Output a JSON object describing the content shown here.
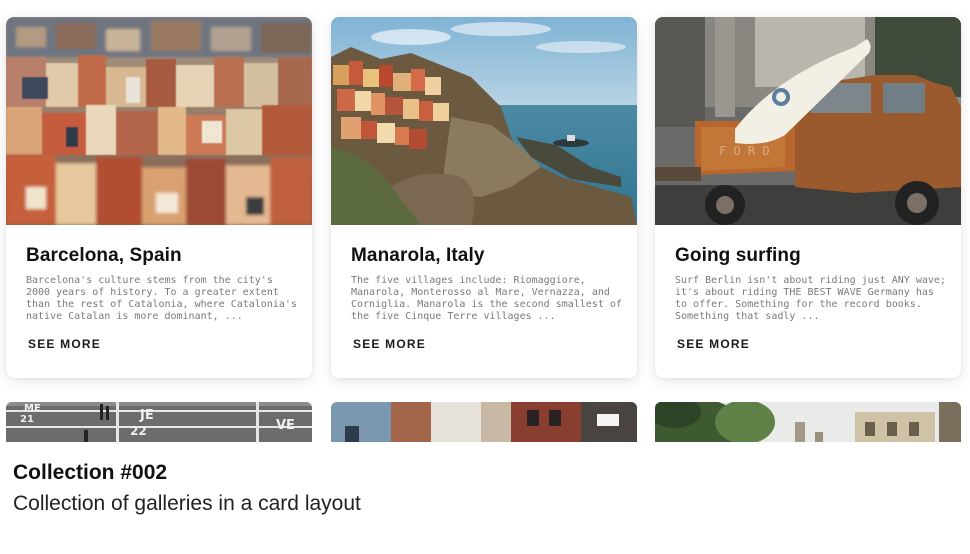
{
  "cards": [
    {
      "title": "Barcelona, Spain",
      "description": "Barcelona's culture stems from the city's 2000 years of history. To a greater extent than the rest of Catalonia, where Catalonia's native Catalan is more dominant, ...",
      "link": "SEE MORE",
      "image": "barcelona-cityscape-photo"
    },
    {
      "title": "Manarola, Italy",
      "description": "The five villages include: Riomaggiore, Manarola, Monterosso al Mare, Vernazza, and Corniglia. Manarola is the second smallest of the five Cinque Terre villages ...",
      "link": "SEE MORE",
      "image": "manarola-coast-photo"
    },
    {
      "title": "Going surfing",
      "description": "Surf Berlin isn't about riding just ANY wave; it's about riding THE BEST WAVE Germany has to offer. Something for the record books. Something that sadly ...",
      "link": "SEE MORE",
      "image": "rusty-truck-surfboard-photo"
    }
  ],
  "peek_row": {
    "card1_labels": [
      "ME",
      "JE",
      "VE",
      "21",
      "22"
    ],
    "card2_image": "brick-street-photo",
    "card3_image": "street-trees-photo"
  },
  "caption": {
    "title": "Collection #002",
    "subtitle": "Collection of galleries in a card layout"
  }
}
